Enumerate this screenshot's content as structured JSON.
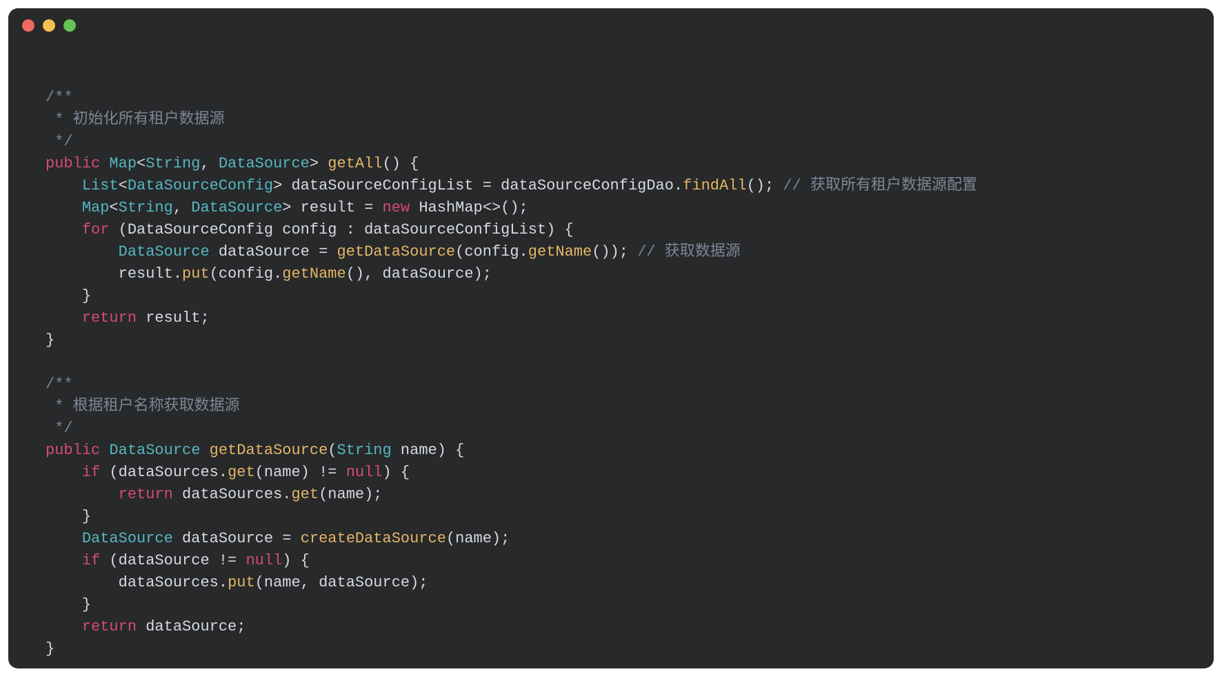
{
  "colors": {
    "background": "#27292a",
    "comment": "#7e8696",
    "keyword": "#d8497b",
    "type": "#56b6c2",
    "function": "#e5b567",
    "plain": "#d7dae0"
  },
  "titlebar": {
    "close": "close",
    "min": "minimize",
    "max": "maximize"
  },
  "code": {
    "javadoc1_open": "/**",
    "javadoc1_body": " * 初始化所有租户数据源",
    "javadoc1_close": " */",
    "m1_sig_public": "public",
    "m1_sig_retA": "Map",
    "m1_sig_lt1": "<",
    "m1_sig_retB": "String",
    "m1_sig_comma": ", ",
    "m1_sig_retC": "DataSource",
    "m1_sig_gt1": ">",
    "m1_sig_name": "getAll",
    "m1_sig_tail": "() {",
    "m1_l1_type1": "List",
    "m1_l1_lt": "<",
    "m1_l1_type2": "DataSourceConfig",
    "m1_l1_gt": ">",
    "m1_l1_rest": " dataSourceConfigList = dataSourceConfigDao.",
    "m1_l1_call": "findAll",
    "m1_l1_tail": "(); ",
    "m1_l1_comment": "// 获取所有租户数据源配置",
    "m1_l2_type1": "Map",
    "m1_l2_lt": "<",
    "m1_l2_type2": "String",
    "m1_l2_comma": ", ",
    "m1_l2_type3": "DataSource",
    "m1_l2_gt": ">",
    "m1_l2_mid": " result = ",
    "m1_l2_new": "new",
    "m1_l2_hash": " HashMap<>();",
    "m1_l3_for": "for",
    "m1_l3_rest": " (DataSourceConfig config : dataSourceConfigList) {",
    "m1_l4_type": "DataSource",
    "m1_l4_mid": " dataSource = ",
    "m1_l4_call": "getDataSource",
    "m1_l4_args": "(config.",
    "m1_l4_call2": "getName",
    "m1_l4_tail": "()); ",
    "m1_l4_comment": "// 获取数据源",
    "m1_l5_pre": "result.",
    "m1_l5_put": "put",
    "m1_l5_args": "(config.",
    "m1_l5_gn": "getName",
    "m1_l5_tail": "(), dataSource);",
    "m1_l6_close": "}",
    "m1_l7_return": "return",
    "m1_l7_rest": " result;",
    "m1_close": "}",
    "javadoc2_open": "/**",
    "javadoc2_body": " * 根据租户名称获取数据源",
    "javadoc2_close": " */",
    "m2_sig_public": "public",
    "m2_sig_ret": "DataSource",
    "m2_sig_name": "getDataSource",
    "m2_sig_openp": "(",
    "m2_sig_argt": "String",
    "m2_sig_tail": " name) {",
    "m2_l1_if": "if",
    "m2_l1_open": " (dataSources.",
    "m2_l1_get": "get",
    "m2_l1_mid": "(name) != ",
    "m2_l1_null": "null",
    "m2_l1_tail": ") {",
    "m2_l2_return": "return",
    "m2_l2_mid": " dataSources.",
    "m2_l2_get": "get",
    "m2_l2_tail": "(name);",
    "m2_l3_close": "}",
    "m2_l4_type": "DataSource",
    "m2_l4_mid": " dataSource = ",
    "m2_l4_call": "createDataSource",
    "m2_l4_tail": "(name);",
    "m2_l5_if": "if",
    "m2_l5_open": " (dataSource != ",
    "m2_l5_null": "null",
    "m2_l5_tail": ") {",
    "m2_l6_pre": "dataSources.",
    "m2_l6_put": "put",
    "m2_l6_tail": "(name, dataSource);",
    "m2_l7_close": "}",
    "m2_l8_return": "return",
    "m2_l8_rest": " dataSource;",
    "m2_close": "}"
  }
}
